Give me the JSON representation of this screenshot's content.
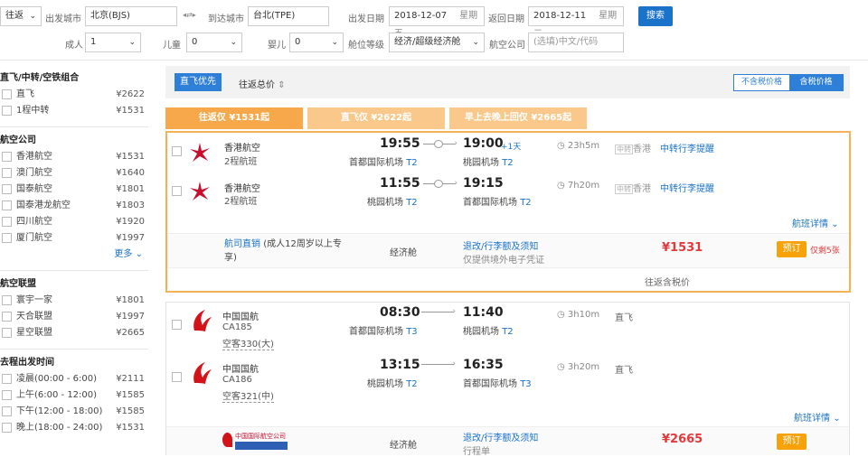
{
  "search": {
    "trip_type": "往返",
    "depart_label": "出发城市",
    "depart_city": "北京(BJS)",
    "swap_icon_text": "◂⇄▸",
    "arrive_label": "到达城市",
    "arrive_city": "台北(TPE)",
    "depart_date_label": "出发日期",
    "depart_date": "2018-12-07",
    "depart_weekday": "星期五",
    "return_date_label": "返回日期",
    "return_date": "2018-12-11",
    "return_weekday": "星期二",
    "search_button": "搜索",
    "adult_label": "成人",
    "adult_value": "1",
    "child_label": "儿童",
    "child_value": "0",
    "infant_label": "婴儿",
    "infant_value": "0",
    "cabin_label": "舱位等级",
    "cabin_value": "经济/超级经济舱",
    "airline_label": "航空公司",
    "airline_placeholder": "(选填)中文/代码"
  },
  "sidebar": {
    "groups": [
      {
        "title": "直飞/中转/空铁组合",
        "items": [
          {
            "name": "直飞",
            "price": "¥2622"
          },
          {
            "name": "1程中转",
            "price": "¥1531"
          }
        ]
      },
      {
        "title": "航空公司",
        "items": [
          {
            "name": "香港航空",
            "price": "¥1531"
          },
          {
            "name": "澳门航空",
            "price": "¥1640"
          },
          {
            "name": "国泰航空",
            "price": "¥1801"
          },
          {
            "name": "国泰港龙航空",
            "price": "¥1803"
          },
          {
            "name": "四川航空",
            "price": "¥1920"
          },
          {
            "name": "厦门航空",
            "price": "¥1997"
          }
        ],
        "more": "更多"
      },
      {
        "title": "航空联盟",
        "items": [
          {
            "name": "寰宇一家",
            "price": "¥1801"
          },
          {
            "name": "天合联盟",
            "price": "¥1997"
          },
          {
            "name": "星空联盟",
            "price": "¥2665"
          }
        ]
      },
      {
        "title": "去程出发时间",
        "items": [
          {
            "name": "凌晨(00:00 - 6:00)",
            "price": "¥2111"
          },
          {
            "name": "上午(6:00 - 12:00)",
            "price": "¥1585"
          },
          {
            "name": "下午(12:00 - 18:00)",
            "price": "¥1585"
          },
          {
            "name": "晚上(18:00 - 24:00)",
            "price": "¥1531"
          }
        ]
      }
    ]
  },
  "toolbar": {
    "direct_first": "直飞优先",
    "sort_total": "往返总价",
    "tax_excluded": "不含税价格",
    "tax_included": "含税价格"
  },
  "tabs": [
    {
      "label": "往返仅 ¥1531起"
    },
    {
      "label": "直飞仅 ¥2622起"
    },
    {
      "label": "早上去晚上回仅 ¥2665起"
    }
  ],
  "card1": {
    "legs": [
      {
        "airline": "香港航空",
        "sub": "2程航班",
        "dep_time": "19:55",
        "dep_apt": "首都国际机场",
        "dep_term": "T2",
        "arr_time": "19:00",
        "arr_plus": "+1天",
        "arr_apt": "桃园机场",
        "arr_term": "T2",
        "duration": "23h5m",
        "stop_tag": "中转",
        "stop_city": "香港",
        "transfer_tip": "中转行李提醒"
      },
      {
        "airline": "香港航空",
        "sub": "2程航班",
        "dep_time": "11:55",
        "dep_apt": "桃园机场",
        "dep_term": "T2",
        "arr_time": "19:15",
        "arr_plus": "",
        "arr_apt": "首都国际机场",
        "arr_term": "T2",
        "duration": "7h20m",
        "stop_tag": "中转",
        "stop_city": "香港",
        "transfer_tip": "中转行李提醒"
      }
    ],
    "details_link": "航班详情",
    "fare_link": "航司直销",
    "fare_desc": "(成人12周岁以上专享)",
    "cabin": "经济舱",
    "rules_link": "退改/行李额及须知",
    "rules_note": "仅提供境外电子凭证",
    "price": "¥1531",
    "book_button": "预订",
    "remaining": "仅剩5张",
    "tax_note": "往返含税价"
  },
  "card2": {
    "legs": [
      {
        "airline": "中国国航",
        "flight_no": "CA185",
        "aircraft": "空客330(大)",
        "dep_time": "08:30",
        "dep_apt": "首都国际机场",
        "dep_term": "T3",
        "arr_time": "11:40",
        "arr_apt": "桃园机场",
        "arr_term": "T2",
        "duration": "3h10m",
        "type": "直飞"
      },
      {
        "airline": "中国国航",
        "flight_no": "CA186",
        "aircraft": "空客321(中)",
        "dep_time": "13:15",
        "dep_apt": "桃园机场",
        "dep_term": "T2",
        "arr_time": "16:35",
        "arr_apt": "首都国际机场",
        "arr_term": "T3",
        "duration": "3h20m",
        "type": "直飞"
      }
    ],
    "details_link": "航班详情",
    "seller_logo_text": "中国国际航空公司",
    "cabin": "经济舱",
    "rules_link": "退改/行李额及须知",
    "rules_note": "行程单",
    "price": "¥2665",
    "book_button": "预订"
  },
  "colors": {
    "accent": "#1a72c9",
    "orange": "#f7a20b",
    "price_red": "#e4393c",
    "tab_active": "#f7a84a",
    "tab_inactive": "#f9c88a"
  }
}
